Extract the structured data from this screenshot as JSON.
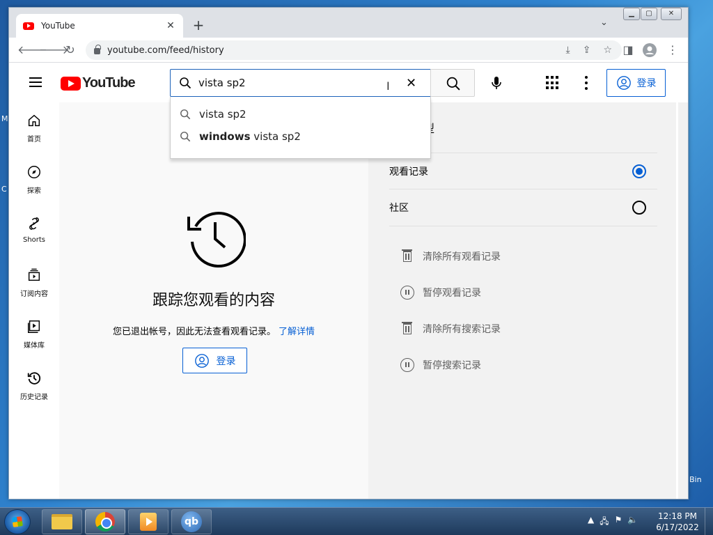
{
  "browser": {
    "tab_title": "YouTube",
    "tab_close": "✕",
    "new_tab": "+",
    "url": "youtube.com/feed/history"
  },
  "youtube": {
    "logo_text": "YouTube",
    "search_value": "vista sp2",
    "signin_label": "登录",
    "suggestions": [
      {
        "bold": "",
        "rest": "vista sp2"
      },
      {
        "bold": "windows",
        "rest": " vista sp2"
      }
    ],
    "guide": [
      {
        "label": "首页",
        "icon": "home-icon"
      },
      {
        "label": "探索",
        "icon": "explore-icon"
      },
      {
        "label": "Shorts",
        "icon": "shorts-icon"
      },
      {
        "label": "订阅内容",
        "icon": "subscriptions-icon"
      },
      {
        "label": "媒体库",
        "icon": "library-icon"
      },
      {
        "label": "历史记录",
        "icon": "history-icon"
      }
    ],
    "history": {
      "title": "跟踪您观看的内容",
      "description": "您已退出帐号，因此无法查看观看记录。",
      "learn_more": "了解详情",
      "signin_label": "登录"
    },
    "sidebar": {
      "section_title_partial": "类型",
      "options": [
        {
          "label": "观看记录",
          "selected": true
        },
        {
          "label": "社区",
          "selected": false
        }
      ],
      "actions": [
        {
          "label": "清除所有观看记录",
          "icon": "trash-icon"
        },
        {
          "label": "暂停观看记录",
          "icon": "pause-icon"
        },
        {
          "label": "清除所有搜索记录",
          "icon": "trash-icon"
        },
        {
          "label": "暂停搜索记录",
          "icon": "pause-icon"
        }
      ]
    }
  },
  "taskbar": {
    "time": "12:18 PM",
    "date": "6/17/2022",
    "qb_label": "qb"
  },
  "desktop": {
    "fragment_bin": "Bin"
  },
  "colors": {
    "accent_blue": "#065fd4",
    "youtube_red": "#ff0000"
  }
}
